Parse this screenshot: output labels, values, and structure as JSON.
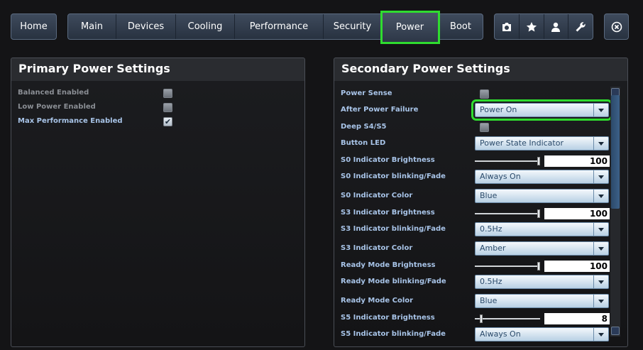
{
  "nav": {
    "home": "Home",
    "tabs": [
      "Main",
      "Devices",
      "Cooling",
      "Performance",
      "Security",
      "Power",
      "Boot"
    ],
    "active_tab": "Power",
    "icons": [
      "camera-icon",
      "star-icon",
      "user-icon",
      "wrench-icon"
    ],
    "close_icon": "close-icon"
  },
  "primary": {
    "title": "Primary Power Settings",
    "items": [
      {
        "label": "Balanced Enabled",
        "checked": false
      },
      {
        "label": "Low Power Enabled",
        "checked": false
      },
      {
        "label": "Max Performance Enabled",
        "checked": true
      }
    ]
  },
  "secondary": {
    "title": "Secondary Power Settings",
    "rows": [
      {
        "label": "Power Sense",
        "type": "checkbox",
        "checked": false
      },
      {
        "label": "After Power Failure",
        "type": "select",
        "value": "Power On",
        "highlighted": true
      },
      {
        "label": "Deep S4/S5",
        "type": "checkbox",
        "checked": false
      },
      {
        "label": "Button LED",
        "type": "select",
        "value": "Power State Indicator"
      },
      {
        "label": "S0 Indicator Brightness",
        "type": "slider",
        "value": "100",
        "level": 1.0
      },
      {
        "label": "S0 Indicator blinking/Fade",
        "type": "select",
        "value": "Always On"
      },
      {
        "label": "S0 Indicator Color",
        "type": "select",
        "value": "Blue"
      },
      {
        "label": "S3 Indicator Brightness",
        "type": "slider",
        "value": "100",
        "level": 1.0
      },
      {
        "label": "S3 Indicator blinking/Fade",
        "type": "select",
        "value": "0.5Hz"
      },
      {
        "label": "S3 Indicator Color",
        "type": "select",
        "value": "Amber"
      },
      {
        "label": "Ready Mode Brightness",
        "type": "slider",
        "value": "100",
        "level": 1.0
      },
      {
        "label": "Ready Mode blinking/Fade",
        "type": "select",
        "value": "0.5Hz"
      },
      {
        "label": "Ready Mode Color",
        "type": "select",
        "value": "Blue"
      },
      {
        "label": "S5 Indicator Brightness",
        "type": "slider",
        "value": "8",
        "level": 0.08
      },
      {
        "label": "S5 Indicator blinking/Fade",
        "type": "select",
        "value": "Always On"
      }
    ]
  },
  "colors": {
    "highlight": "#2fdc2f",
    "label_blue": "#a8c4e8",
    "label_gray": "#8a8e94"
  }
}
